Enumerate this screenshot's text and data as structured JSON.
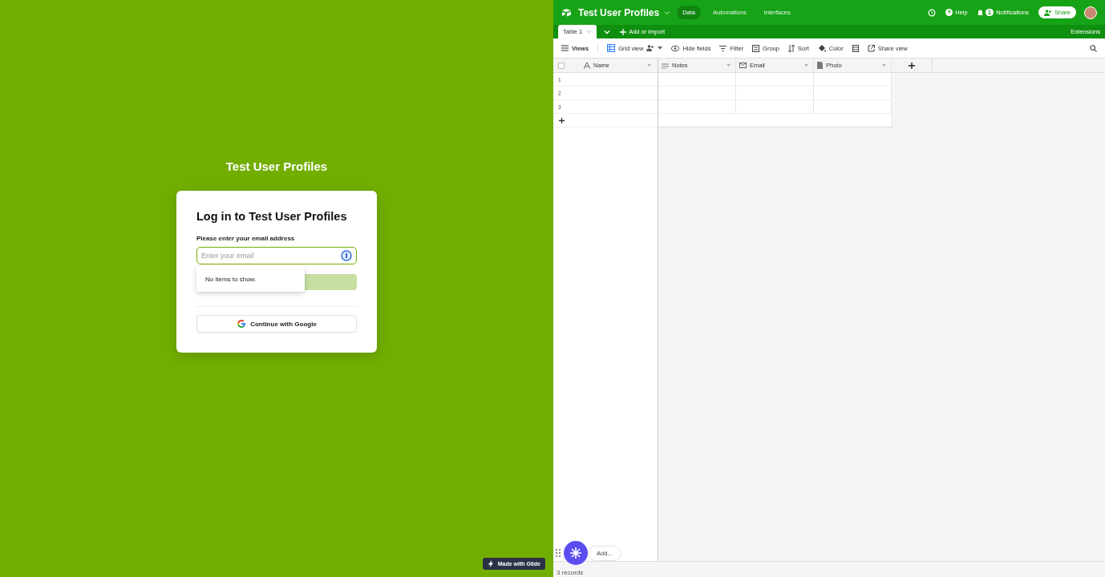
{
  "app": {
    "title": "Test User Profiles",
    "login": {
      "heading": "Log in to Test User Profiles",
      "label": "Please enter your email address",
      "placeholder": "Enter your email",
      "dropdown": "No items to show.",
      "google_button": "Continue with Google"
    },
    "badge": "Made with Glide"
  },
  "base": {
    "title": "Test User Profiles",
    "nav": [
      {
        "label": "Data",
        "selected": true
      },
      {
        "label": "Automations",
        "selected": false
      },
      {
        "label": "Interfaces",
        "selected": false
      }
    ],
    "help": "Help",
    "notifications": {
      "label": "Notifications",
      "count": "1"
    },
    "share": "Share",
    "tables": [
      {
        "label": "Table 1",
        "selected": true
      }
    ],
    "add_import": "Add or import",
    "extensions": "Extensions",
    "toolbar": [
      {
        "kind": "views",
        "label": "Views"
      },
      {
        "kind": "grid",
        "label": "Grid view"
      },
      {
        "kind": "hide",
        "label": "Hide fields"
      },
      {
        "kind": "filter",
        "label": "Filter"
      },
      {
        "kind": "group",
        "label": "Group"
      },
      {
        "kind": "sort",
        "label": "Sort"
      },
      {
        "kind": "color",
        "label": "Color"
      },
      {
        "kind": "height"
      },
      {
        "kind": "share",
        "label": "Share view"
      }
    ],
    "select_all": {
      "checked": false
    },
    "columns": [
      {
        "kind": "text",
        "label": "Name"
      },
      {
        "kind": "notes",
        "label": "Notes"
      },
      {
        "kind": "email",
        "label": "Email"
      },
      {
        "kind": "file",
        "label": "Photo"
      }
    ],
    "rows": [
      {
        "number": "1"
      },
      {
        "number": "2"
      },
      {
        "number": "3"
      }
    ],
    "add_record": "Add...",
    "record_count": "3 records"
  }
}
